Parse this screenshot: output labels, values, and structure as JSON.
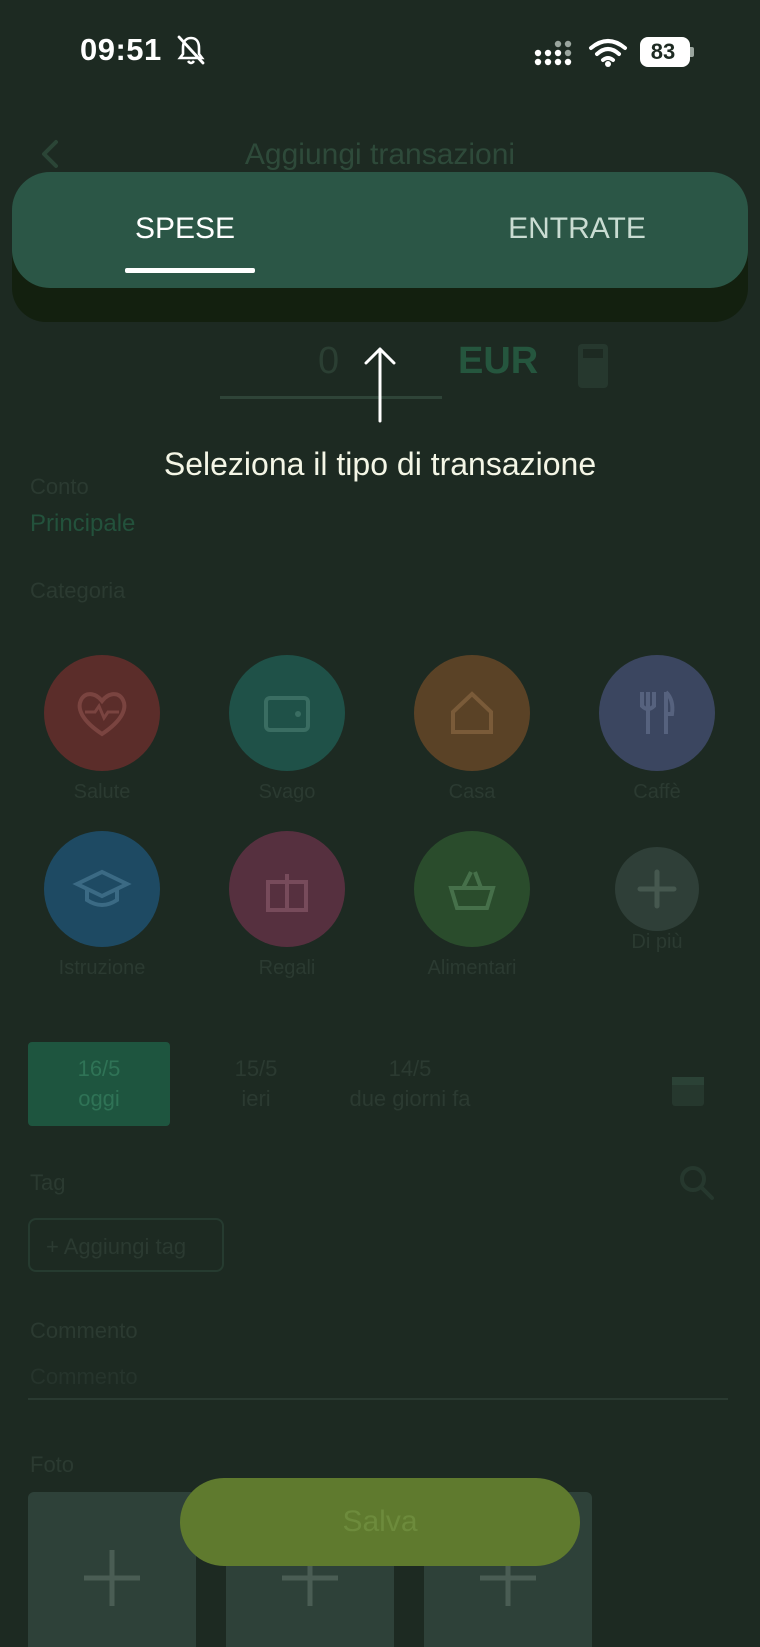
{
  "status_bar": {
    "time": "09:51",
    "battery": "83"
  },
  "app": {
    "title": "Aggiungi transazioni",
    "amount": "0",
    "currency": "EUR",
    "account_label": "Conto",
    "account_value": "Principale",
    "category_label": "Categoria",
    "categories": [
      {
        "label": "Salute",
        "icon": "heart-pulse-icon",
        "color": "#5b2d2a"
      },
      {
        "label": "Svago",
        "icon": "wallet-icon",
        "color": "#1f5148"
      },
      {
        "label": "Casa",
        "icon": "house-icon",
        "color": "#5a4226"
      },
      {
        "label": "Caffè",
        "icon": "utensils-icon",
        "color": "#3b4660"
      },
      {
        "label": "Istruzione",
        "icon": "graduation-cap-icon",
        "color": "#1e4a63"
      },
      {
        "label": "Regali",
        "icon": "gift-icon",
        "color": "#56303f"
      },
      {
        "label": "Alimentari",
        "icon": "basket-icon",
        "color": "#2a4c2c"
      },
      {
        "label": "Di più",
        "icon": "plus-icon",
        "color": "#2f3f38"
      }
    ],
    "dates": [
      {
        "date": "16/5",
        "label": "oggi"
      },
      {
        "date": "15/5",
        "label": "ieri"
      },
      {
        "date": "14/5",
        "label": "due giorni fa"
      }
    ],
    "tag_label": "Tag",
    "add_tag": "+ Aggiungi tag",
    "comment_label": "Commento",
    "comment_placeholder": "Commento",
    "photo_label": "Foto",
    "save_label": "Salva"
  },
  "coach": {
    "tabs": [
      "SPESE",
      "ENTRATE"
    ],
    "active_tab": "SPESE",
    "hint": "Seleziona il tipo di transazione"
  },
  "colors": {
    "overlay_bg": "#1d2a22",
    "tab_bar": "#2b5646",
    "indicator": "#ffffff",
    "hint_text": "#f4f6e6"
  }
}
